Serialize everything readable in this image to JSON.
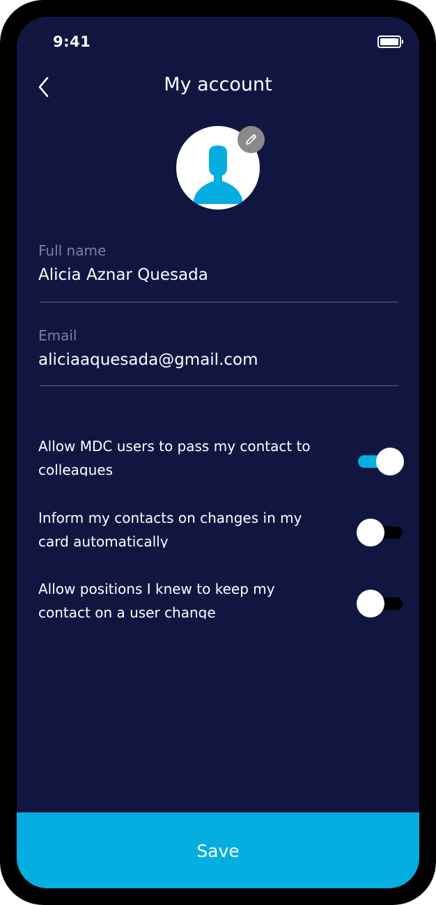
{
  "status_bar": {
    "time": "9:41",
    "battery_icon": "battery-full-icon"
  },
  "header": {
    "back_icon": "chevron-left-icon",
    "title": "My account"
  },
  "profile": {
    "avatar_icon": "user-silhouette-icon",
    "edit_icon": "pencil-icon",
    "avatar_color": "#05aee0",
    "edit_badge_color": "#8a8a8a"
  },
  "form": {
    "full_name": {
      "label": "Full name",
      "value": "Alicia Aznar Quesada"
    },
    "email": {
      "label": "Email",
      "value": "aliciaaquesada@gmail.com"
    }
  },
  "toggles": [
    {
      "label": "Allow MDC users to pass my contact to colleagues",
      "on": true
    },
    {
      "label": "Inform my contacts on changes in my card automatically",
      "on": false
    },
    {
      "label": "Allow positions I knew to keep my contact on a user change",
      "on": false
    }
  ],
  "footer": {
    "save_label": "Save"
  },
  "colors": {
    "background": "#111641",
    "accent": "#05aee0",
    "label_muted": "#7c809e",
    "divider": "#3b4066"
  }
}
